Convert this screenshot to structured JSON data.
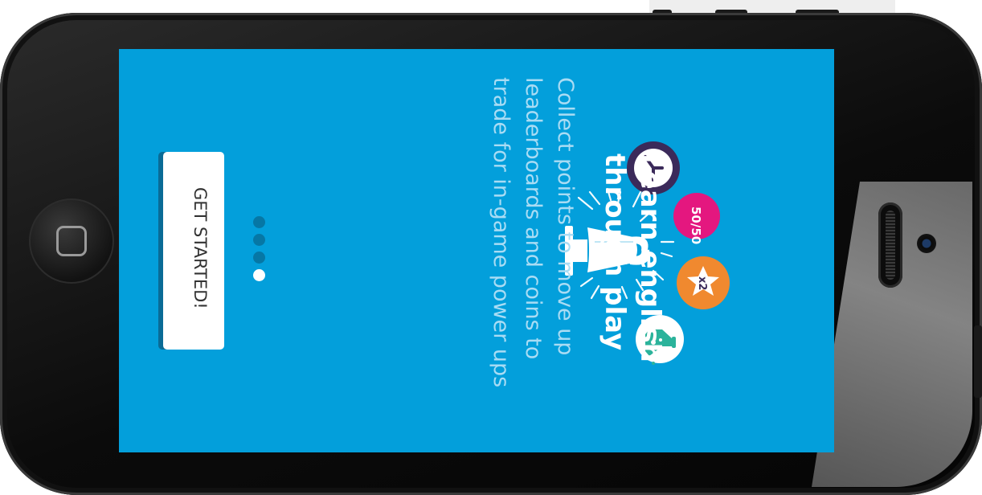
{
  "screen": {
    "headline_line1": "Learn english",
    "headline_line2": "through play",
    "subtext_line1": "Collect points to move up",
    "subtext_line2": "leaderboards and coins to",
    "subtext_line3": "trade for in-game power ups",
    "cta_label": "GET STARTED!",
    "pager": {
      "total": 4,
      "active_index": 3
    },
    "powerups": {
      "fifty_fifty": "50/50",
      "double": "x2"
    }
  },
  "colors": {
    "screen_bg": "#039fdb",
    "headline": "#ffffff",
    "subtext": "#a9dcf4",
    "clock_ring": "#3b2a5a",
    "fifty_bg": "#e4177f",
    "double_bg": "#f0892f",
    "flask_color": "#2bb39b"
  },
  "icons": [
    "trophy-icon",
    "clock-icon",
    "fifty-fifty-icon",
    "double-points-icon",
    "flask-icon"
  ]
}
